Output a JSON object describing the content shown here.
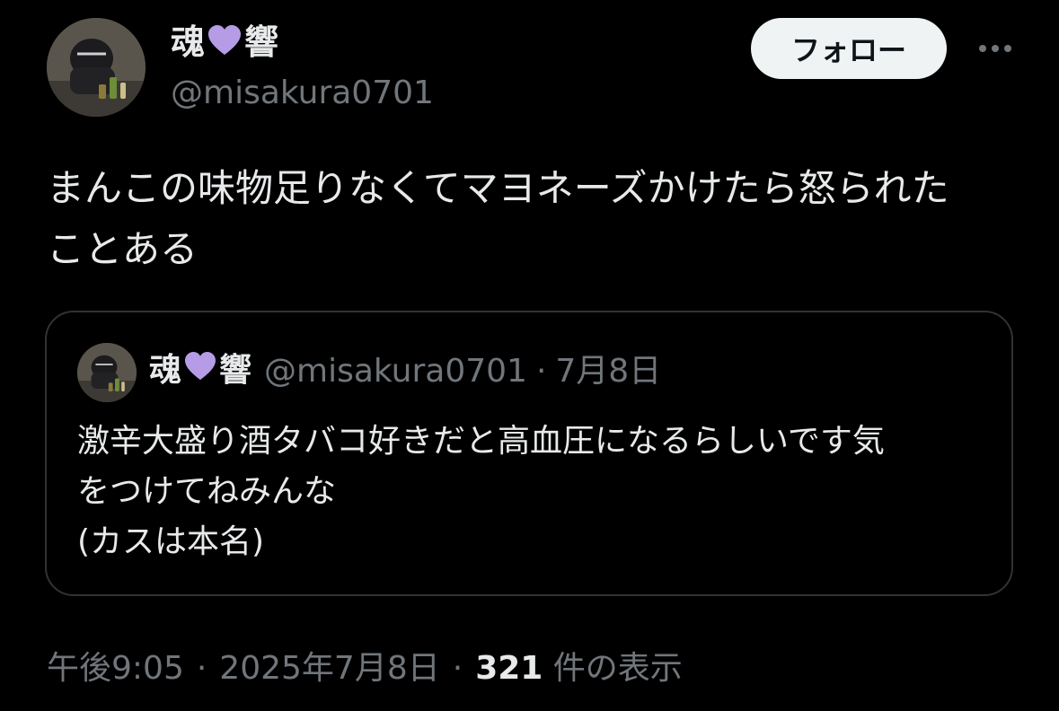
{
  "author": {
    "name_part1": "魂",
    "name_part2": "響",
    "name_heart_color": "#b69ce6",
    "handle": "@misakura0701"
  },
  "follow_button_label": "フォロー",
  "more_icon": "more-horizontal-icon",
  "tweet_text": "まんこの味物足りなくてマヨネーズかけたら怒られた\nことある",
  "quoted_tweet": {
    "name_part1": "魂",
    "name_part2": "響",
    "handle": "@misakura0701",
    "separator": "·",
    "date": "7月8日",
    "text": "激辛大盛り酒タバコ好きだと高血圧になるらしいです気\nをつけてねみんな\n(カスは本名)"
  },
  "meta": {
    "time": "午後9:05",
    "separator": "·",
    "date": "2025年7月8日",
    "views_count": "321",
    "views_label": " 件の表示"
  },
  "colors": {
    "background": "#000000",
    "text_primary": "#e7e9ea",
    "text_secondary": "#71767b",
    "border": "#2f3336",
    "follow_button_bg": "#eff3f4"
  }
}
